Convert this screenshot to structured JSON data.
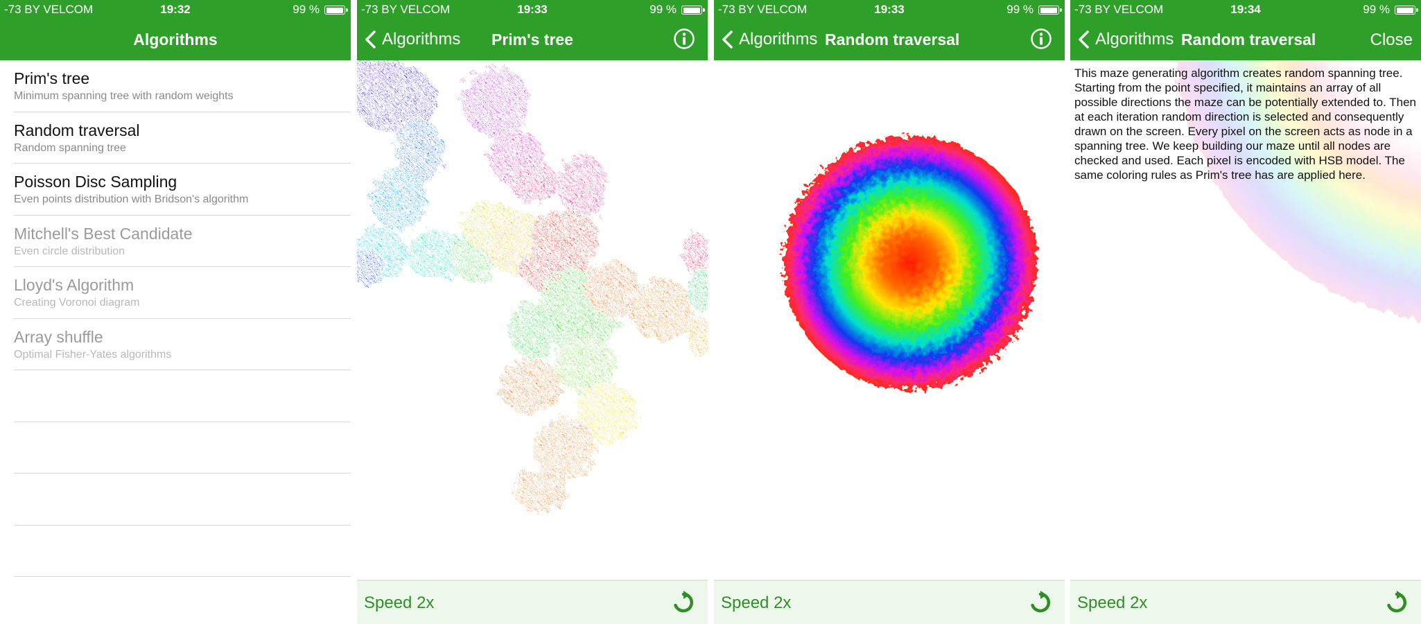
{
  "status": {
    "carrier": "-73 BY VELCOM",
    "battery": "99 %",
    "times": [
      "19:32",
      "19:33",
      "19:33",
      "19:34"
    ]
  },
  "colors": {
    "nav_green": "#2ea02a",
    "bottom_bar": "#eef7ec",
    "speed_text": "#2f8f26"
  },
  "screen1": {
    "title": "Algorithms",
    "items": [
      {
        "title": "Prim's tree",
        "subtitle": "Minimum spanning tree with random weights",
        "enabled": true
      },
      {
        "title": "Random traversal",
        "subtitle": "Random spanning tree",
        "enabled": true
      },
      {
        "title": "Poisson Disc Sampling",
        "subtitle": "Even points distribution with Bridson's algorithm",
        "enabled": true
      },
      {
        "title": "Mitchell's Best Candidate",
        "subtitle": "Even circle distribution",
        "enabled": false
      },
      {
        "title": "Lloyd's Algorithm",
        "subtitle": "Creating Voronoi diagram",
        "enabled": false
      },
      {
        "title": "Array shuffle",
        "subtitle": "Optimal Fisher-Yates algorithms",
        "enabled": false
      }
    ]
  },
  "screen2": {
    "back": "Algorithms",
    "title": "Prim's tree",
    "info_icon": "info-circle-icon",
    "speed": "Speed 2x",
    "reset_icon": "reset-icon"
  },
  "screen3": {
    "back": "Algorithms",
    "title": "Random traversal",
    "info_icon": "info-circle-icon",
    "speed": "Speed 2x",
    "reset_icon": "reset-icon"
  },
  "screen4": {
    "back": "Algorithms",
    "title": "Random traversal",
    "close": "Close",
    "description": "This maze generating algorithm creates random spanning tree. Starting from the point specified, it maintains an array of all possible directions the maze can be potentially extended to. Then at each iteration random direction is selected and consequently drawn on the screen. Every pixel on the screen acts as node in a spanning tree. We keep building our maze until all nodes are checked and used. Each pixel is encoded with HSB model. The same coloring rules as Prim's tree has are applied here.",
    "speed": "Speed 2x",
    "reset_icon": "reset-icon"
  }
}
